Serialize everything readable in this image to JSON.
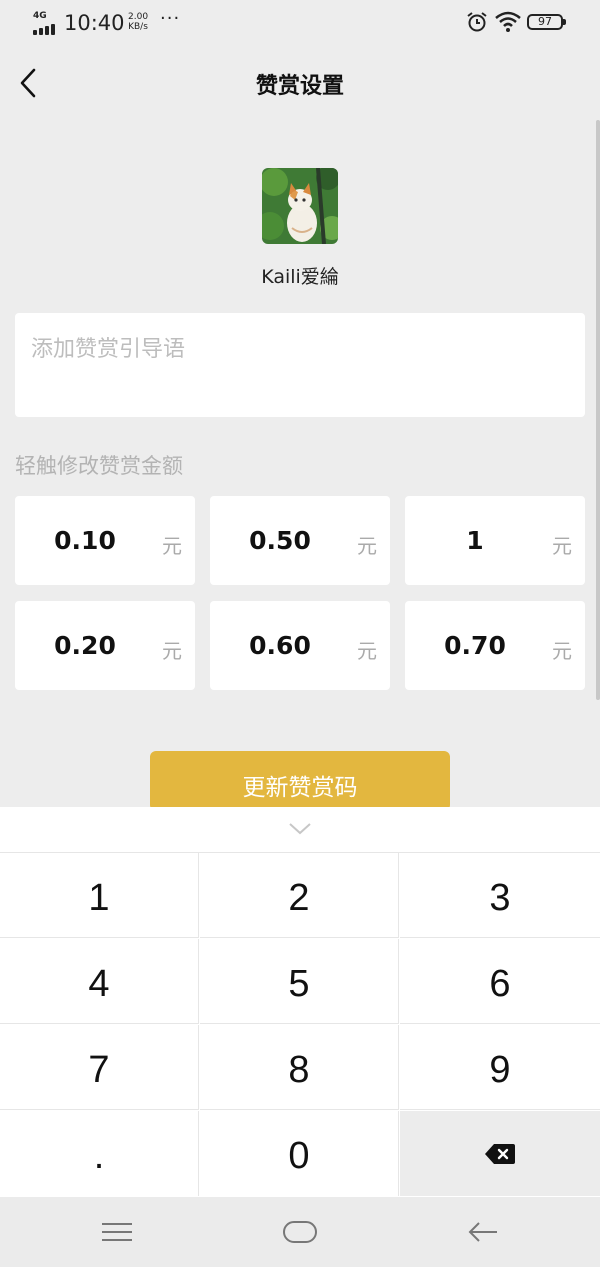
{
  "status_bar": {
    "network": "4G",
    "time": "10:40",
    "speed_value": "2.00",
    "speed_unit": "KB/s",
    "more": "···",
    "battery": "97"
  },
  "header": {
    "title": "赞赏设置",
    "back_icon": "chevron-left-icon"
  },
  "profile": {
    "username": "Kaili爱綸"
  },
  "guide_input": {
    "placeholder": "添加赞赏引导语"
  },
  "amounts": {
    "label": "轻触修改赞赏金额",
    "unit": "元",
    "items": [
      {
        "value": "0.10"
      },
      {
        "value": "0.50"
      },
      {
        "value": "1"
      },
      {
        "value": "0.20"
      },
      {
        "value": "0.60"
      },
      {
        "value": "0.70"
      }
    ]
  },
  "update_button": {
    "label": "更新赞赏码",
    "color": "#e3b73f"
  },
  "keypad": {
    "keys": [
      "1",
      "2",
      "3",
      "4",
      "5",
      "6",
      "7",
      "8",
      "9",
      ".",
      "0"
    ],
    "delete_icon": "backspace-icon",
    "collapse_icon": "chevron-down-icon"
  },
  "nav_bar": {
    "menu_icon": "menu-icon",
    "home_icon": "home-icon",
    "back_icon": "back-arrow-icon"
  }
}
